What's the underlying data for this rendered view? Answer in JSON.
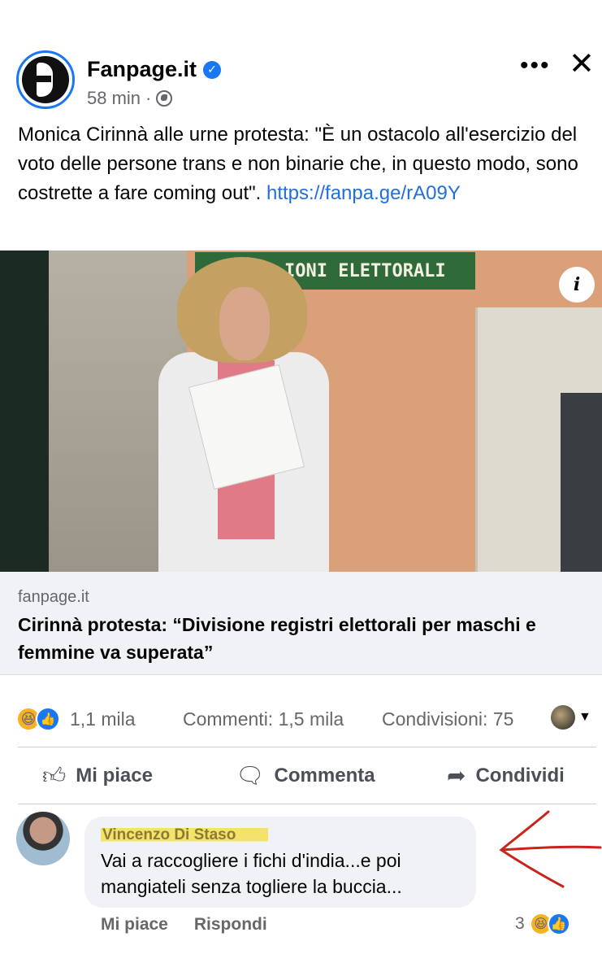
{
  "header": {
    "page_name": "Fanpage.it",
    "time": "58 min",
    "separator": "·",
    "more_label": "•••",
    "close_label": "✕"
  },
  "post": {
    "text": "Monica Cirinnà alle urne protesta: \"È un ostacolo all'esercizio del voto delle persone trans e non binarie che, in questo modo, sono costrette a fare coming out\". ",
    "link": "https://fanpa.ge/rA09Y"
  },
  "photo": {
    "sign_text": "IONI ELETTORALI",
    "info_label": "i"
  },
  "link_card": {
    "domain": "fanpage.it",
    "title": "Cirinnà protesta: “Divisione registri elettorali per maschi e femmine va superata”"
  },
  "stats": {
    "reactions": "1,1 mila",
    "comments": "Commenti: 1,5 mila",
    "shares": "Condivisioni: 75"
  },
  "actions": {
    "like": "Mi piace",
    "comment": "Commenta",
    "share": "Condividi"
  },
  "comment": {
    "author": "Vincenzo Di Staso",
    "text": "Vai a raccogliere i fichi d'india...e poi mangiateli senza togliere la buccia...",
    "like_label": "Mi piace",
    "reply_label": "Rispondi",
    "reaction_count": "3"
  },
  "colors": {
    "accent": "#1877f2",
    "link": "#216fdb",
    "annotation": "#c8241c",
    "highlight": "#f4e36a"
  }
}
